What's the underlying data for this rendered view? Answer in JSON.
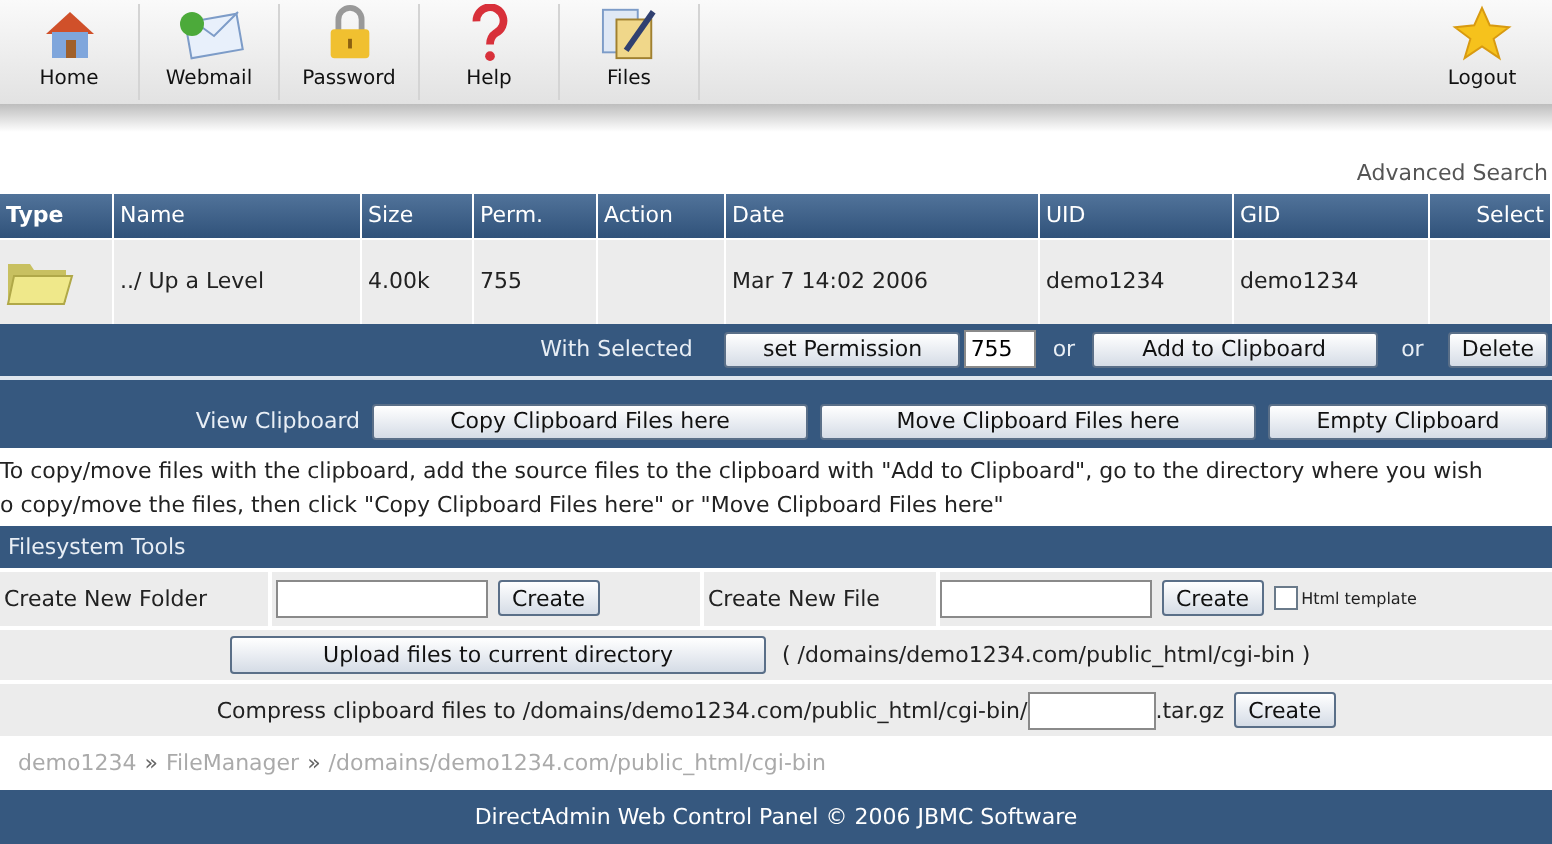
{
  "toolbar": {
    "items": [
      {
        "label": "Home"
      },
      {
        "label": "Webmail"
      },
      {
        "label": "Password"
      },
      {
        "label": "Help"
      },
      {
        "label": "Files"
      }
    ],
    "logout": {
      "label": "Logout"
    }
  },
  "advanced_search": "Advanced Search",
  "table": {
    "columns": [
      "Type",
      "Name",
      "Size",
      "Perm.",
      "Action",
      "Date",
      "UID",
      "GID",
      "Select"
    ],
    "rows": [
      {
        "kind": "folder",
        "name": "../ Up a Level",
        "size": "4.00k",
        "perm": "755",
        "date": "Mar 7 14:02 2006",
        "uid": "demo1234",
        "gid": "demo1234"
      }
    ]
  },
  "with_selected": {
    "label": "With Selected",
    "permission_button": "set Permission",
    "permission_value": "755",
    "or_1": "or",
    "clipboard_button": "Add to Clipboard",
    "or_2": "or",
    "delete_button": "Delete"
  },
  "view_clipboard": {
    "label": "View Clipboard",
    "buttons": [
      "Copy Clipboard Files here",
      "Move Clipboard Files here",
      "Empty Clipboard"
    ]
  },
  "help_lines": [
    "To copy/move files with the clipboard, add the source files to the clipboard with \"Add to Clipboard\", go to the directory where you wish",
    "o copy/move the files, then click \"Copy Clipboard Files here\" or \"Move Clipboard Files here\""
  ],
  "filesystem_tools": {
    "title": "Filesystem Tools",
    "create_folder": {
      "label": "Create New Folder",
      "button": "Create"
    },
    "create_file": {
      "label": "Create New File",
      "button": "Create",
      "checkbox": {
        "label": "Html template",
        "checked": false
      }
    },
    "upload": {
      "button": "Upload files to current directory",
      "path": "( /domains/demo1234.com/public_html/cgi-bin )"
    },
    "compress": {
      "prefix": "Compress clipboard files to /domains/demo1234.com/public_html/cgi-bin/",
      "suffix": ".tar.gz",
      "button": "Create"
    }
  },
  "breadcrumb": [
    {
      "kind": "link",
      "label": "demo1234"
    },
    {
      "kind": "separator",
      "label": "»"
    },
    {
      "kind": "link",
      "label": "FileManager"
    },
    {
      "kind": "separator",
      "label": "»"
    },
    {
      "kind": "link",
      "label": "/domains/demo1234.com/public_html/cgi-bin"
    }
  ],
  "footer": "DirectAdmin Web Control Panel © 2006 JBMC Software"
}
